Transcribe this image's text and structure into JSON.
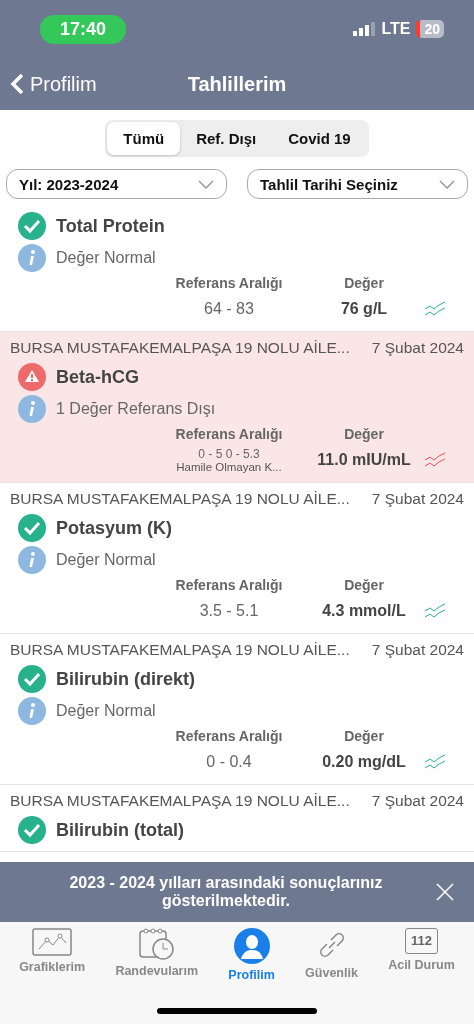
{
  "status_bar": {
    "time": "17:40",
    "network": "LTE",
    "battery": "20"
  },
  "nav": {
    "back": "Profilim",
    "title": "Tahlillerim"
  },
  "segments": [
    {
      "label": "Tümü",
      "selected": true
    },
    {
      "label": "Ref. Dışı",
      "selected": false
    },
    {
      "label": "Covid 19",
      "selected": false
    }
  ],
  "filters": [
    {
      "value": "Yıl: 2023-2024"
    },
    {
      "value": "Tahlil Tarihi Seçiniz"
    }
  ],
  "results": [
    {
      "kind": "normal",
      "title": "Total Protein",
      "note": "Değer Normal",
      "range_label": "Referans Aralığı",
      "value_label": "Değer",
      "range": "64 - 83",
      "value": "76 g/L"
    },
    {
      "kind": "alert",
      "source": "BURSA MUSTAFAKEMALPAŞA 19 NOLU AİLE...",
      "date": "7 Şubat 2024",
      "title": "Beta-hCG",
      "note": "1 Değer Referans Dışı",
      "range_label": "Referans Aralığı",
      "value_label": "Değer",
      "range": "0 - 5 0 - 5.3",
      "range_note": "Hamile Olmayan K...",
      "value": "11.0 mIU/mL"
    },
    {
      "kind": "normal",
      "source": "BURSA MUSTAFAKEMALPAŞA 19 NOLU AİLE...",
      "date": "7 Şubat 2024",
      "title": "Potasyum (K)",
      "note": "Değer Normal",
      "range_label": "Referans Aralığı",
      "value_label": "Değer",
      "range": "3.5 - 5.1",
      "value": "4.3 mmol/L"
    },
    {
      "kind": "normal",
      "source": "BURSA MUSTAFAKEMALPAŞA 19 NOLU AİLE...",
      "date": "7 Şubat 2024",
      "title": "Bilirubin (direkt)",
      "note": "Değer Normal",
      "range_label": "Referans Aralığı",
      "value_label": "Değer",
      "range": "0 - 0.4",
      "value": "0.20 mg/dL"
    },
    {
      "kind": "normal",
      "source": "BURSA MUSTAFAKEMALPAŞA 19 NOLU AİLE...",
      "date": "7 Şubat 2024",
      "title": "Bilirubin (total)"
    }
  ],
  "banner": {
    "text": "2023 - 2024 yılları arasındaki sonuçlarınız gösterilmektedir."
  },
  "tab_bar": [
    {
      "kind": "charts",
      "label": "Grafiklerim",
      "selected": false
    },
    {
      "kind": "appointments",
      "label": "Randevularım",
      "selected": false
    },
    {
      "kind": "profile",
      "label": "Profilim",
      "selected": true
    },
    {
      "kind": "security",
      "label": "Güvenlik",
      "selected": false
    },
    {
      "kind": "emergency",
      "label": "Acil Durum",
      "badge": "112",
      "selected": false
    }
  ]
}
